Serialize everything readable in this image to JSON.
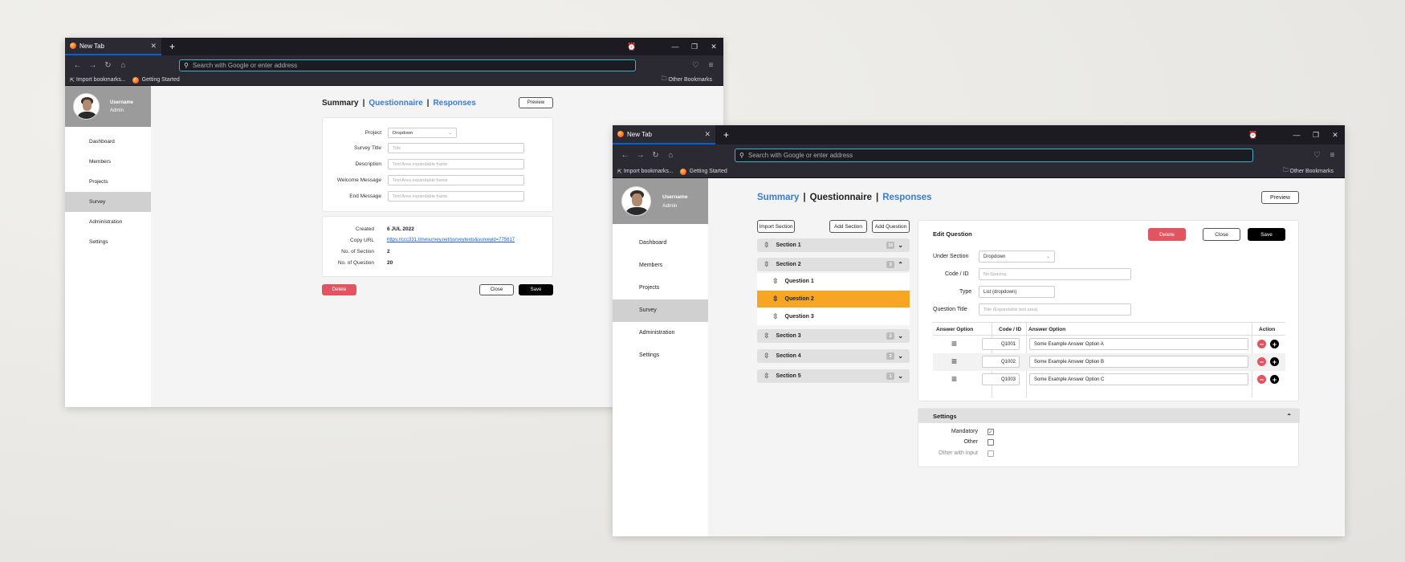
{
  "browser": {
    "tab_title": "New Tab",
    "url_placeholder": "Search with Google or enter address",
    "bookmarks": [
      "Import bookmarks...",
      "Getting Started"
    ],
    "other_bookmarks": "Other Bookmarks"
  },
  "profile": {
    "name": "Username",
    "role": "Admin"
  },
  "nav": [
    "Dashboard",
    "Members",
    "Projects",
    "Survey",
    "Administration",
    "Settings"
  ],
  "nav_active": "Survey",
  "tabs": {
    "summary": "Summary",
    "questionnaire": "Questionnaire",
    "responses": "Responses"
  },
  "buttons": {
    "preview": "Preview",
    "delete": "Delete",
    "close": "Close",
    "save": "Save"
  },
  "summary": {
    "fields": [
      {
        "label": "Project",
        "value": "Dropdown"
      },
      {
        "label": "Survey Title",
        "placeholder": "Title"
      },
      {
        "label": "Description",
        "placeholder": "Text Area expandable frame"
      },
      {
        "label": "Welcome Message",
        "placeholder": "Text Area expandable frame"
      },
      {
        "label": "End Message",
        "placeholder": "Text Area expandable frame"
      }
    ],
    "info": [
      {
        "label": "Created",
        "value": "6 JUL 2022"
      },
      {
        "label": "Copy URL",
        "value": "https://ccc331.timesurvey.net/surveytexts&surveyid=775617"
      },
      {
        "label": "No. of Section",
        "value": "2"
      },
      {
        "label": "No. of Question",
        "value": "20"
      }
    ]
  },
  "questionnaire": {
    "actions": {
      "import": "Import Section",
      "add_section": "Add Section",
      "add_question": "Add Question"
    },
    "sections": [
      {
        "label": "Section 1",
        "count": "10",
        "expanded": false
      },
      {
        "label": "Section 2",
        "count": "3",
        "expanded": true,
        "questions": [
          "Question 1",
          "Question 2",
          "Question 3"
        ],
        "selected": "Question 2"
      },
      {
        "label": "Section 3",
        "count": "2",
        "expanded": false
      },
      {
        "label": "Section 4",
        "count": "2",
        "expanded": false
      },
      {
        "label": "Section 5",
        "count": "1",
        "expanded": false
      }
    ],
    "edit": {
      "title": "Edit Question",
      "fields": [
        {
          "label": "Under Section",
          "value": "Dropdown"
        },
        {
          "label": "Code / ID",
          "placeholder": "No Spacing"
        },
        {
          "label": "Type",
          "value": "List (dropdown)"
        },
        {
          "label": "Question Title",
          "placeholder": "Title (Expandable text area)"
        }
      ],
      "table_headers": {
        "option": "Answer Option",
        "code": "Code / ID",
        "answer": "Answer Option",
        "action": "Action"
      },
      "rows": [
        {
          "code": "Q1001",
          "answer": "Some Example Answer Option A"
        },
        {
          "code": "Q1002",
          "answer": "Some Example Answer Option B"
        },
        {
          "code": "Q1003",
          "answer": "Some Example Answer Option C"
        }
      ]
    },
    "settings": {
      "title": "Settings",
      "options": [
        {
          "label": "Mandatory",
          "checked": true
        },
        {
          "label": "Other",
          "checked": false
        },
        {
          "label": "Other with input",
          "checked": false
        }
      ]
    }
  },
  "colors": {
    "accent": "#3a7bd5",
    "selected": "#f6a623",
    "danger": "#e05561"
  }
}
